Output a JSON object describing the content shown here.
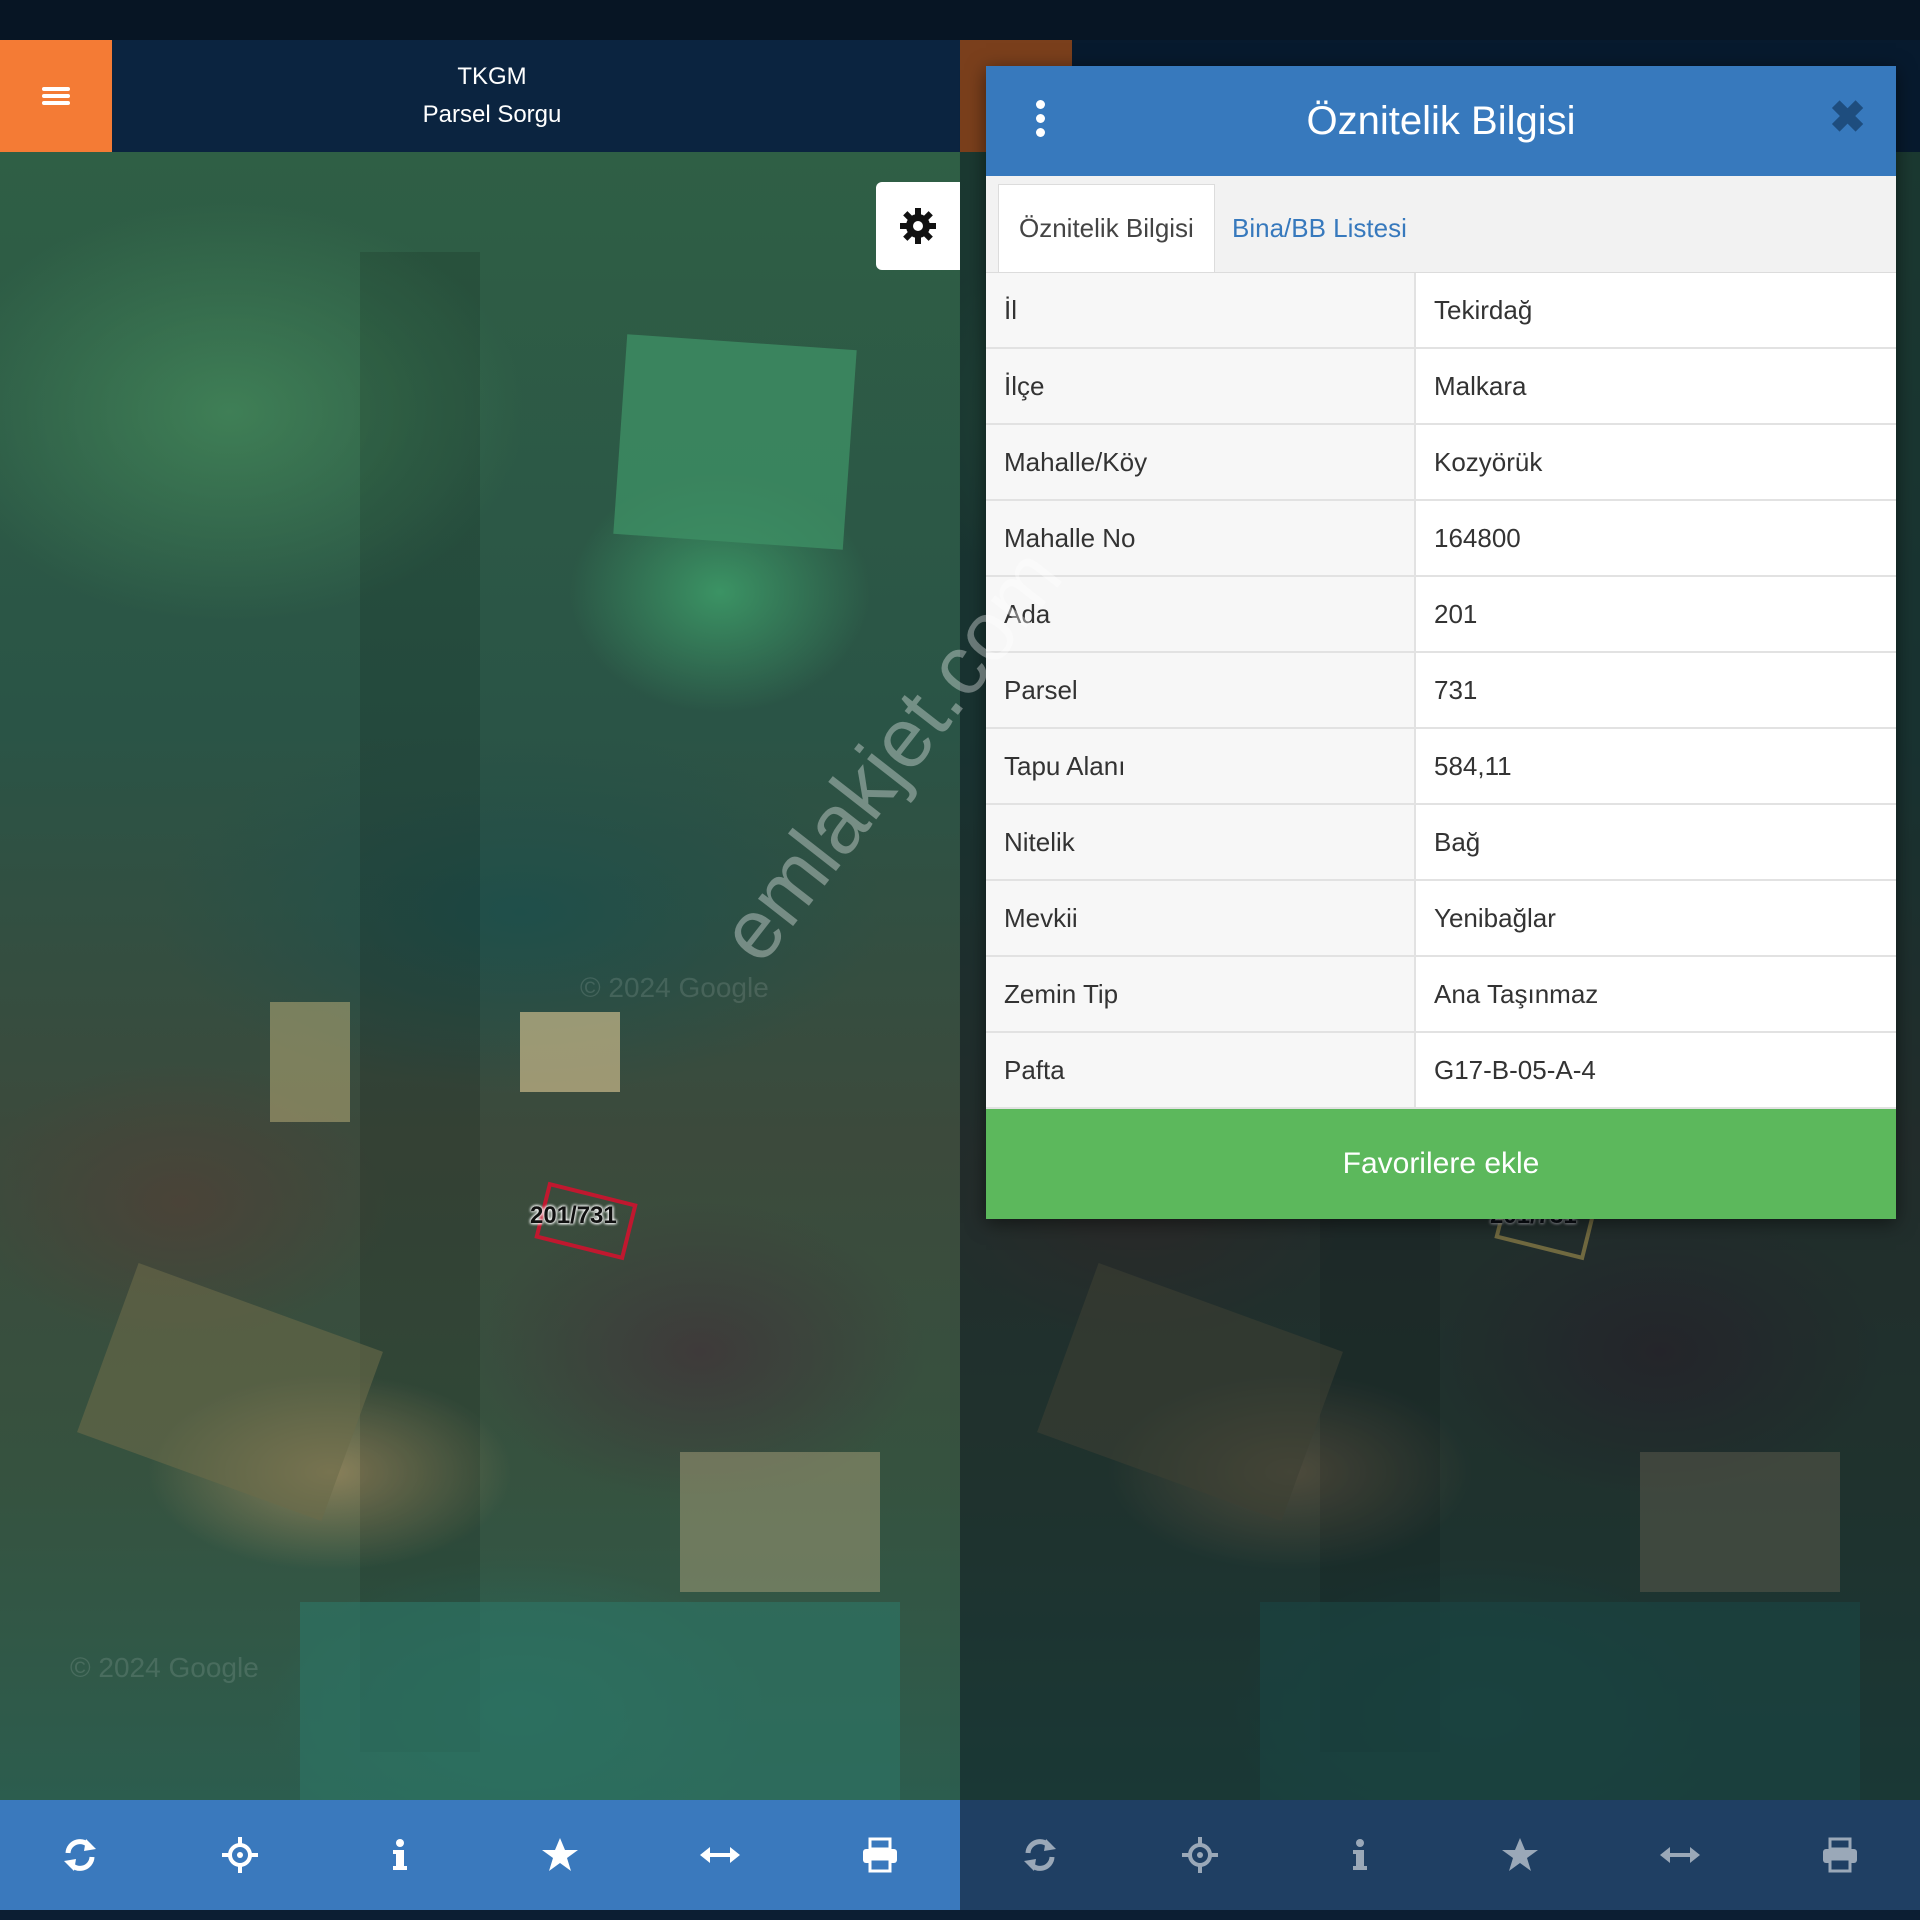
{
  "header": {
    "line1": "TKGM",
    "line2": "Parsel Sorgu"
  },
  "parcel_label": "201/731",
  "map_copyright": "© 2024 Google",
  "watermark": "emlakjet.com",
  "toolbar": {
    "icons": [
      "refresh-icon",
      "crosshair-icon",
      "info-icon",
      "star-icon",
      "measure-icon",
      "print-icon"
    ]
  },
  "panel": {
    "title": "Öznitelik Bilgisi",
    "tabs": [
      "Öznitelik Bilgisi",
      "Bina/BB Listesi"
    ],
    "rows": [
      {
        "key": "İl",
        "value": "Tekirdağ"
      },
      {
        "key": "İlçe",
        "value": "Malkara"
      },
      {
        "key": "Mahalle/Köy",
        "value": "Kozyörük"
      },
      {
        "key": "Mahalle No",
        "value": "164800"
      },
      {
        "key": "Ada",
        "value": "201"
      },
      {
        "key": "Parsel",
        "value": "731"
      },
      {
        "key": "Tapu Alanı",
        "value": "584,11"
      },
      {
        "key": "Nitelik",
        "value": "Bağ"
      },
      {
        "key": "Mevkii",
        "value": "Yenibağlar"
      },
      {
        "key": "Zemin Tip",
        "value": "Ana Taşınmaz"
      },
      {
        "key": "Pafta",
        "value": "G17-B-05-A-4"
      }
    ],
    "favorite_label": "Favorilere ekle"
  },
  "colors": {
    "accent": "#f47b35",
    "header_blue": "#3779bd",
    "success": "#5cb85c",
    "navy": "#0b2440"
  }
}
